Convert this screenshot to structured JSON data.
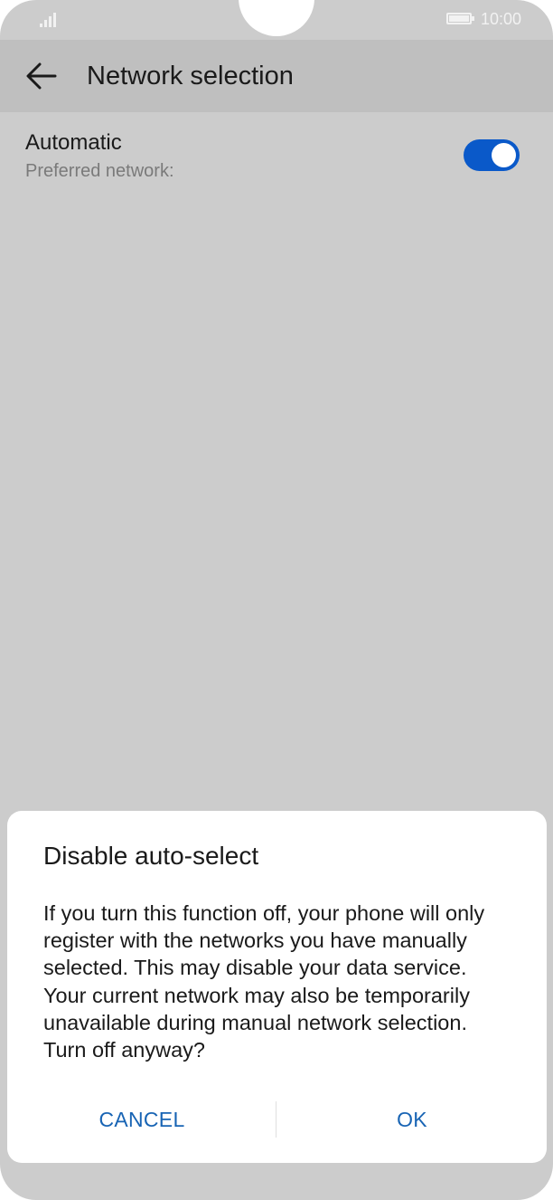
{
  "status_bar": {
    "time": "10:00",
    "signal_icon": "signal-icon",
    "battery_icon": "battery-icon"
  },
  "app_bar": {
    "title": "Network selection",
    "back_icon": "arrow-left-icon"
  },
  "setting": {
    "title": "Automatic",
    "subtitle": "Preferred network:",
    "toggle_on": true
  },
  "dialog": {
    "title": "Disable auto-select",
    "body": "If you turn this function off, your phone will only register with the networks you have manually selected. This may disable your data service. Your current network may also be temporarily unavailable during manual network selection. Turn off anyway?",
    "cancel_label": "CANCEL",
    "ok_label": "OK"
  },
  "colors": {
    "accent": "#0a59c9",
    "button_text": "#1864b4",
    "scrim_background": "#cccccc"
  }
}
